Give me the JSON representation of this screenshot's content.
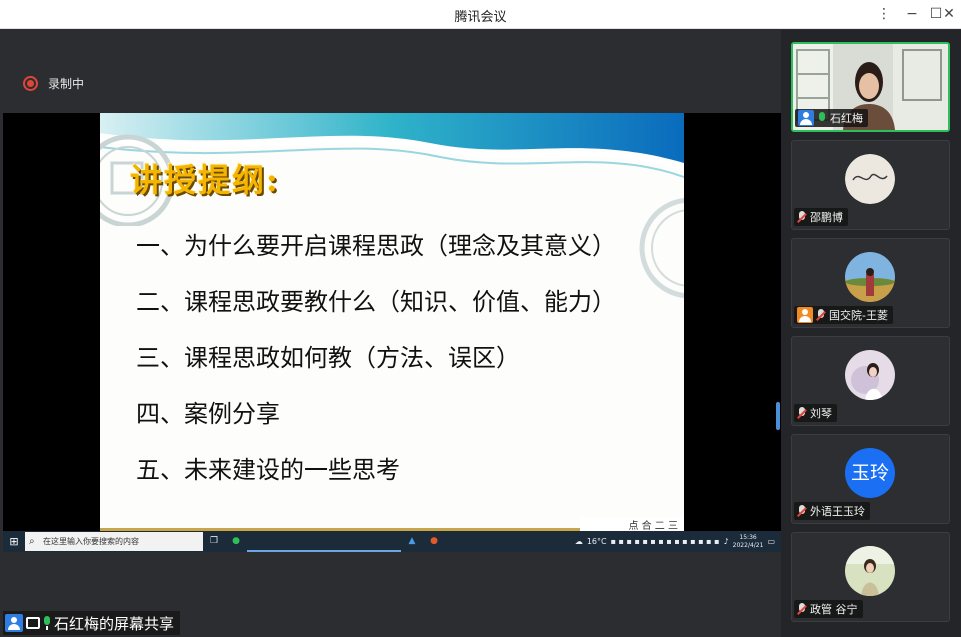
{
  "window": {
    "title": "腾讯会议",
    "controls": {
      "settings": "⋮",
      "minimize": "−",
      "maximize": "☐",
      "close": "✕"
    }
  },
  "recording": {
    "label": "录制中",
    "color": "#e0453a"
  },
  "slide": {
    "title": "讲授提纲:",
    "items": [
      "一、为什么要开启课程思政（理念及其意义）",
      "二、课程思政要教什么（知识、价值、能力）",
      "三、课程思政如何教（方法、误区）",
      "四、案例分享",
      "五、未来建设的一些思考"
    ],
    "footer_text": "点 合 二 三"
  },
  "taskbar": {
    "start_icon": "windows-icon",
    "search_placeholder": "在这里输入你要搜索的内容",
    "weather": "16°C",
    "time": "15:36",
    "date": "2022/4/21"
  },
  "share_label": {
    "text": "石红梅的屏幕共享"
  },
  "participants": [
    {
      "name": "石红梅",
      "type": "video",
      "mic": "on",
      "badge": "blue",
      "active": true
    },
    {
      "name": "邵鹏博",
      "type": "avatar-signature",
      "mic": "muted"
    },
    {
      "name": "国交院-王菱",
      "type": "avatar-landscape",
      "mic": "muted",
      "badge": "orange"
    },
    {
      "name": "刘琴",
      "type": "avatar-person",
      "mic": "muted"
    },
    {
      "name": "外语王玉玲",
      "type": "text-avatar",
      "initials": "玉玲",
      "mic": "muted"
    },
    {
      "name": "政管 谷宁",
      "type": "avatar-person2",
      "mic": "muted"
    }
  ],
  "colors": {
    "accent": "#2f7de1",
    "active_border": "#2fbf5a",
    "slide_title": "#f5b400"
  }
}
